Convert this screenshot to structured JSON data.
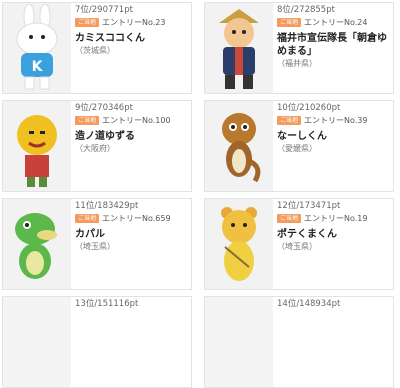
{
  "cards": [
    {
      "rank": "7位/290771pt",
      "badge": "ご当地",
      "entry": "エントリーNo.23",
      "name": "カミスココくん",
      "pref": "（茨城県）"
    },
    {
      "rank": "8位/272855pt",
      "badge": "ご当地",
      "entry": "エントリーNo.24",
      "name": "福井市宣伝隊長「朝倉ゆめまる」",
      "pref": "（福井県）"
    },
    {
      "rank": "9位/270346pt",
      "badge": "ご当地",
      "entry": "エントリーNo.100",
      "name": "造ノ道ゆずる",
      "pref": "（大阪府）"
    },
    {
      "rank": "10位/210260pt",
      "badge": "ご当地",
      "entry": "エントリーNo.39",
      "name": "なーしくん",
      "pref": "（愛媛県）"
    },
    {
      "rank": "11位/183429pt",
      "badge": "ご当地",
      "entry": "エントリーNo.659",
      "name": "カパル",
      "pref": "（埼玉県）"
    },
    {
      "rank": "12位/173471pt",
      "badge": "ご当地",
      "entry": "エントリーNo.19",
      "name": "ポテくまくん",
      "pref": "（埼玉県）"
    },
    {
      "rank": "13位/151116pt"
    },
    {
      "rank": "14位/148934pt"
    }
  ],
  "colors": {
    "badge": "#f39c5d",
    "border": "#e3e3e3"
  },
  "icons": [
    "white-rabbit-mascot-icon",
    "samurai-mascot-icon",
    "yuzu-mascot-icon",
    "pear-mascot-icon",
    "kappa-mascot-icon",
    "potato-bear-mascot-icon"
  ]
}
